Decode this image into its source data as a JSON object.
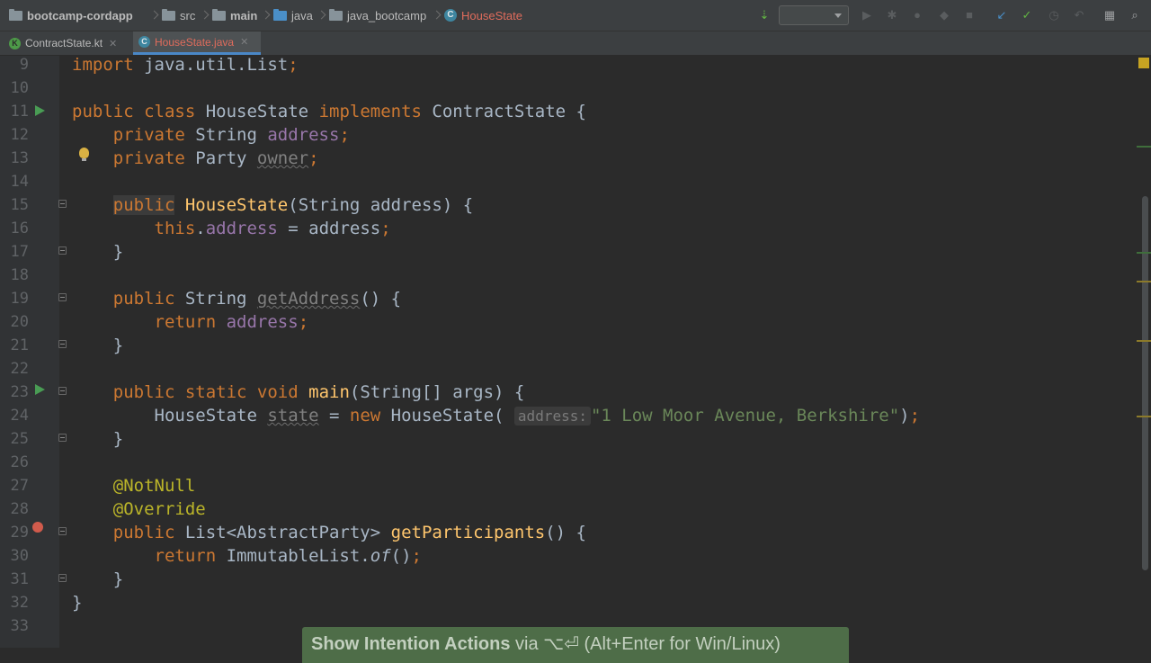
{
  "breadcrumbs": [
    {
      "label": "bootcamp-cordapp",
      "kind": "project"
    },
    {
      "label": "src",
      "kind": "folder"
    },
    {
      "label": "main",
      "kind": "folder"
    },
    {
      "label": "java",
      "kind": "source-folder"
    },
    {
      "label": "java_bootcamp",
      "kind": "package"
    },
    {
      "label": "HouseState",
      "kind": "class"
    }
  ],
  "tabs": [
    {
      "label": "ContractState.kt",
      "active": false,
      "icon": "kotlin-file-icon"
    },
    {
      "label": "HouseState.java",
      "active": true,
      "icon": "java-class-icon"
    }
  ],
  "toolbar": {
    "run_config_value": "",
    "icons": [
      "build-icon",
      "run-icon",
      "debug-icon",
      "coverage-icon",
      "profile-icon",
      "stop-icon",
      "vcs-update-icon",
      "vcs-commit-icon",
      "vcs-history-icon",
      "revert-icon",
      "project-structure-icon"
    ]
  },
  "editor": {
    "lines": [
      {
        "num": "9",
        "code": "import java.util.List;"
      },
      {
        "num": "10",
        "code": ""
      },
      {
        "num": "11",
        "code": "public class HouseState implements ContractState {"
      },
      {
        "num": "12",
        "code": "    private String address;"
      },
      {
        "num": "13",
        "code": "    private Party owner;"
      },
      {
        "num": "14",
        "code": ""
      },
      {
        "num": "15",
        "code": "    public HouseState(String address) {"
      },
      {
        "num": "16",
        "code": "        this.address = address;"
      },
      {
        "num": "17",
        "code": "    }"
      },
      {
        "num": "18",
        "code": ""
      },
      {
        "num": "19",
        "code": "    public String getAddress() {"
      },
      {
        "num": "20",
        "code": "        return address;"
      },
      {
        "num": "21",
        "code": "    }"
      },
      {
        "num": "22",
        "code": ""
      },
      {
        "num": "23",
        "code": "    public static void main(String[] args) {"
      },
      {
        "num": "24",
        "code": "        HouseState state = new HouseState( address: \"1 Low Moor Avenue, Berkshire\");"
      },
      {
        "num": "25",
        "code": "    }"
      },
      {
        "num": "26",
        "code": ""
      },
      {
        "num": "27",
        "code": "    @NotNull"
      },
      {
        "num": "28",
        "code": "    @Override"
      },
      {
        "num": "29",
        "code": "    public List<AbstractParty> getParticipants() {"
      },
      {
        "num": "30",
        "code": "        return ImmutableList.of();"
      },
      {
        "num": "31",
        "code": "    }"
      },
      {
        "num": "32",
        "code": "}"
      },
      {
        "num": "33",
        "code": ""
      }
    ],
    "param_hint": "address:"
  },
  "hint_banner": {
    "action": "Show Intention Actions",
    "via": " via ",
    "shortcut": "⌥⏎ (Alt+Enter for Win/Linux)"
  }
}
